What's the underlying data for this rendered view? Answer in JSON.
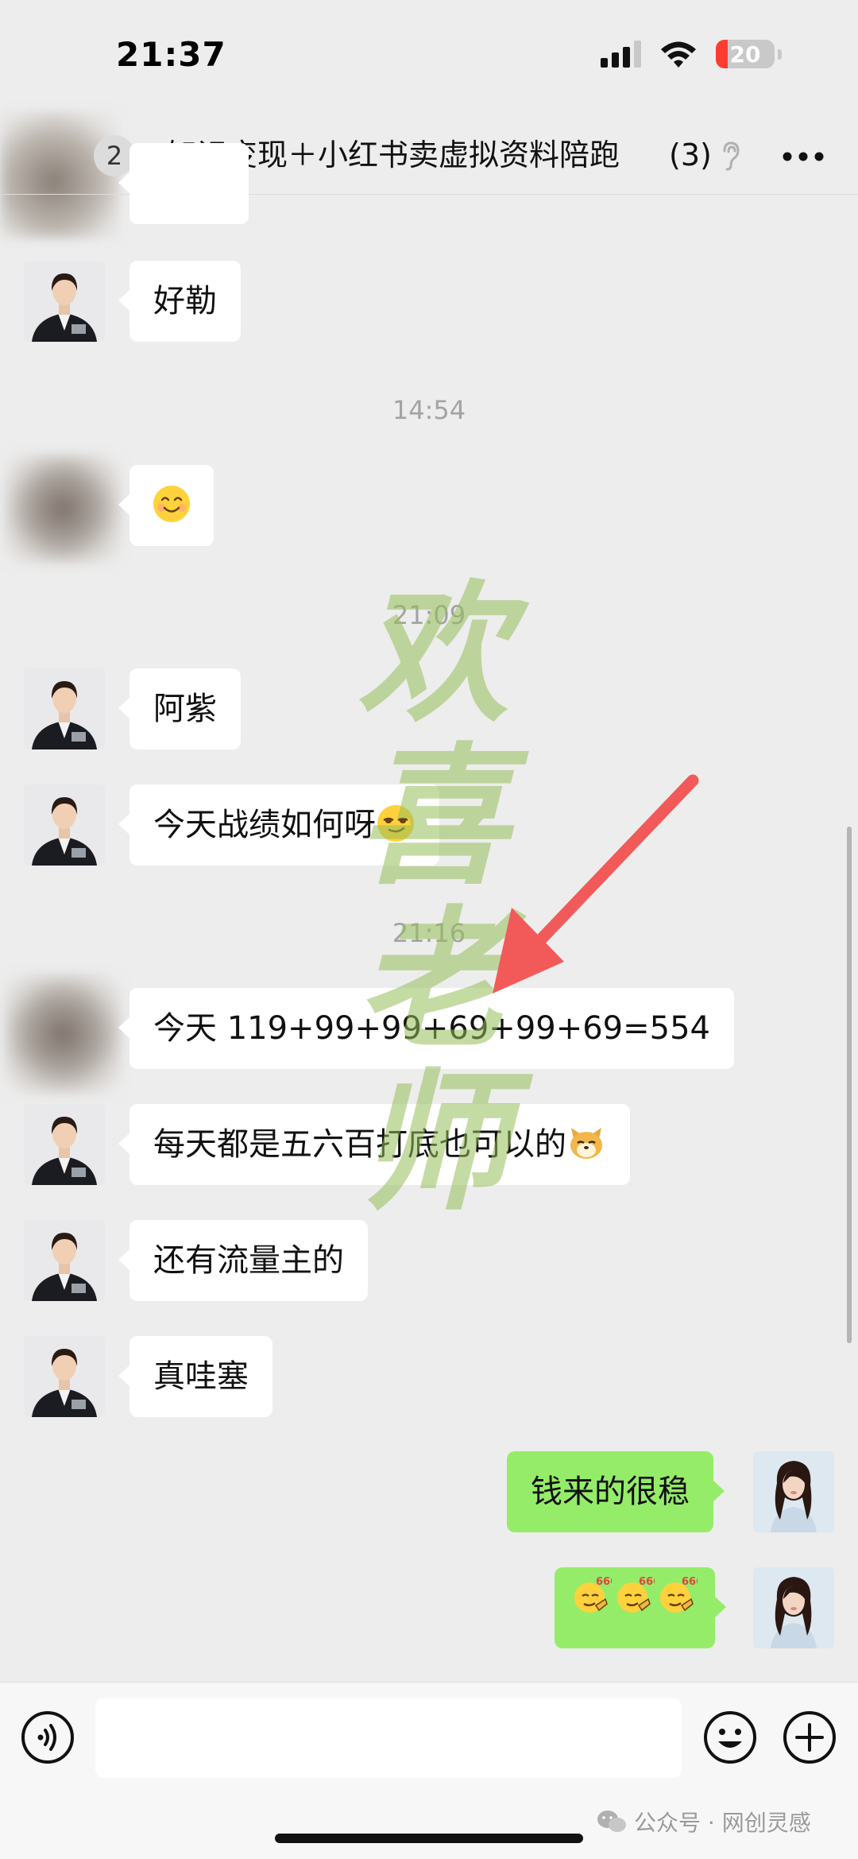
{
  "status_bar": {
    "time": "21:37",
    "battery": "20"
  },
  "header": {
    "back_badge": "2",
    "title": "知识变现＋小红书卖虚拟资料陪跑",
    "member_count": "(3)"
  },
  "messages": [
    {
      "side": "left",
      "text": "好勒"
    },
    {
      "timestamp": "14:54"
    },
    {
      "side": "left",
      "emoji": "smiling-face"
    },
    {
      "timestamp": "21:09"
    },
    {
      "side": "left",
      "text": "阿紫"
    },
    {
      "side": "left",
      "text": "今天战绩如何呀",
      "emoji": "smirking-face"
    },
    {
      "timestamp": "21:16"
    },
    {
      "side": "left",
      "text": "今天 119+99+99+69+99+69=554"
    },
    {
      "side": "left",
      "text": "每天都是五六百打底也可以的",
      "emoji": "dog-face"
    },
    {
      "side": "left",
      "text": "还有流量主的"
    },
    {
      "side": "left",
      "text": "真哇塞"
    },
    {
      "side": "right",
      "text": "钱来的很稳"
    },
    {
      "side": "right",
      "emoji_label": "666",
      "emoji_count": 3
    }
  ],
  "watermark": {
    "chars": [
      "欢",
      "喜",
      "老",
      "师"
    ]
  },
  "footer": {
    "credit": "公众号 · 网创灵感"
  },
  "colors": {
    "background": "#ededed",
    "bubble_self": "#95ec69",
    "bubble_other": "#ffffff",
    "arrow": "#f25a5a",
    "watermark": "#96be5a"
  }
}
